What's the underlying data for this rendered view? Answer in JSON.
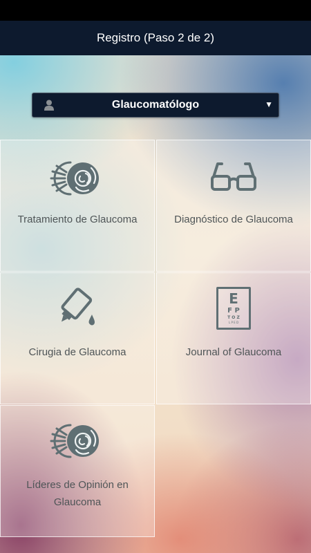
{
  "header": {
    "title": "Registro (Paso 2 de 2)"
  },
  "profile_select": {
    "value": "Glaucomatólogo",
    "icon": "user-icon",
    "caret": "▼"
  },
  "tiles": [
    {
      "label": "Tratamiento de Glaucoma",
      "icon": "eye-laser-icon"
    },
    {
      "label": "Diagnóstico de Glaucoma",
      "icon": "glasses-icon"
    },
    {
      "label": "Cirugia de Glaucoma",
      "icon": "eye-drops-icon"
    },
    {
      "label": "Journal of Glaucoma",
      "icon": "eye-chart-icon"
    },
    {
      "label": "Líderes de Opinión en Glaucoma",
      "icon": "eye-laser-icon"
    }
  ],
  "eye_chart": {
    "row1": "E",
    "row2": "F P",
    "row3": "T O Z",
    "row4": "L P E D"
  },
  "colors": {
    "header_bg": "#0d1a2e",
    "icon": "#5f6f73",
    "label": "#4f5557"
  }
}
